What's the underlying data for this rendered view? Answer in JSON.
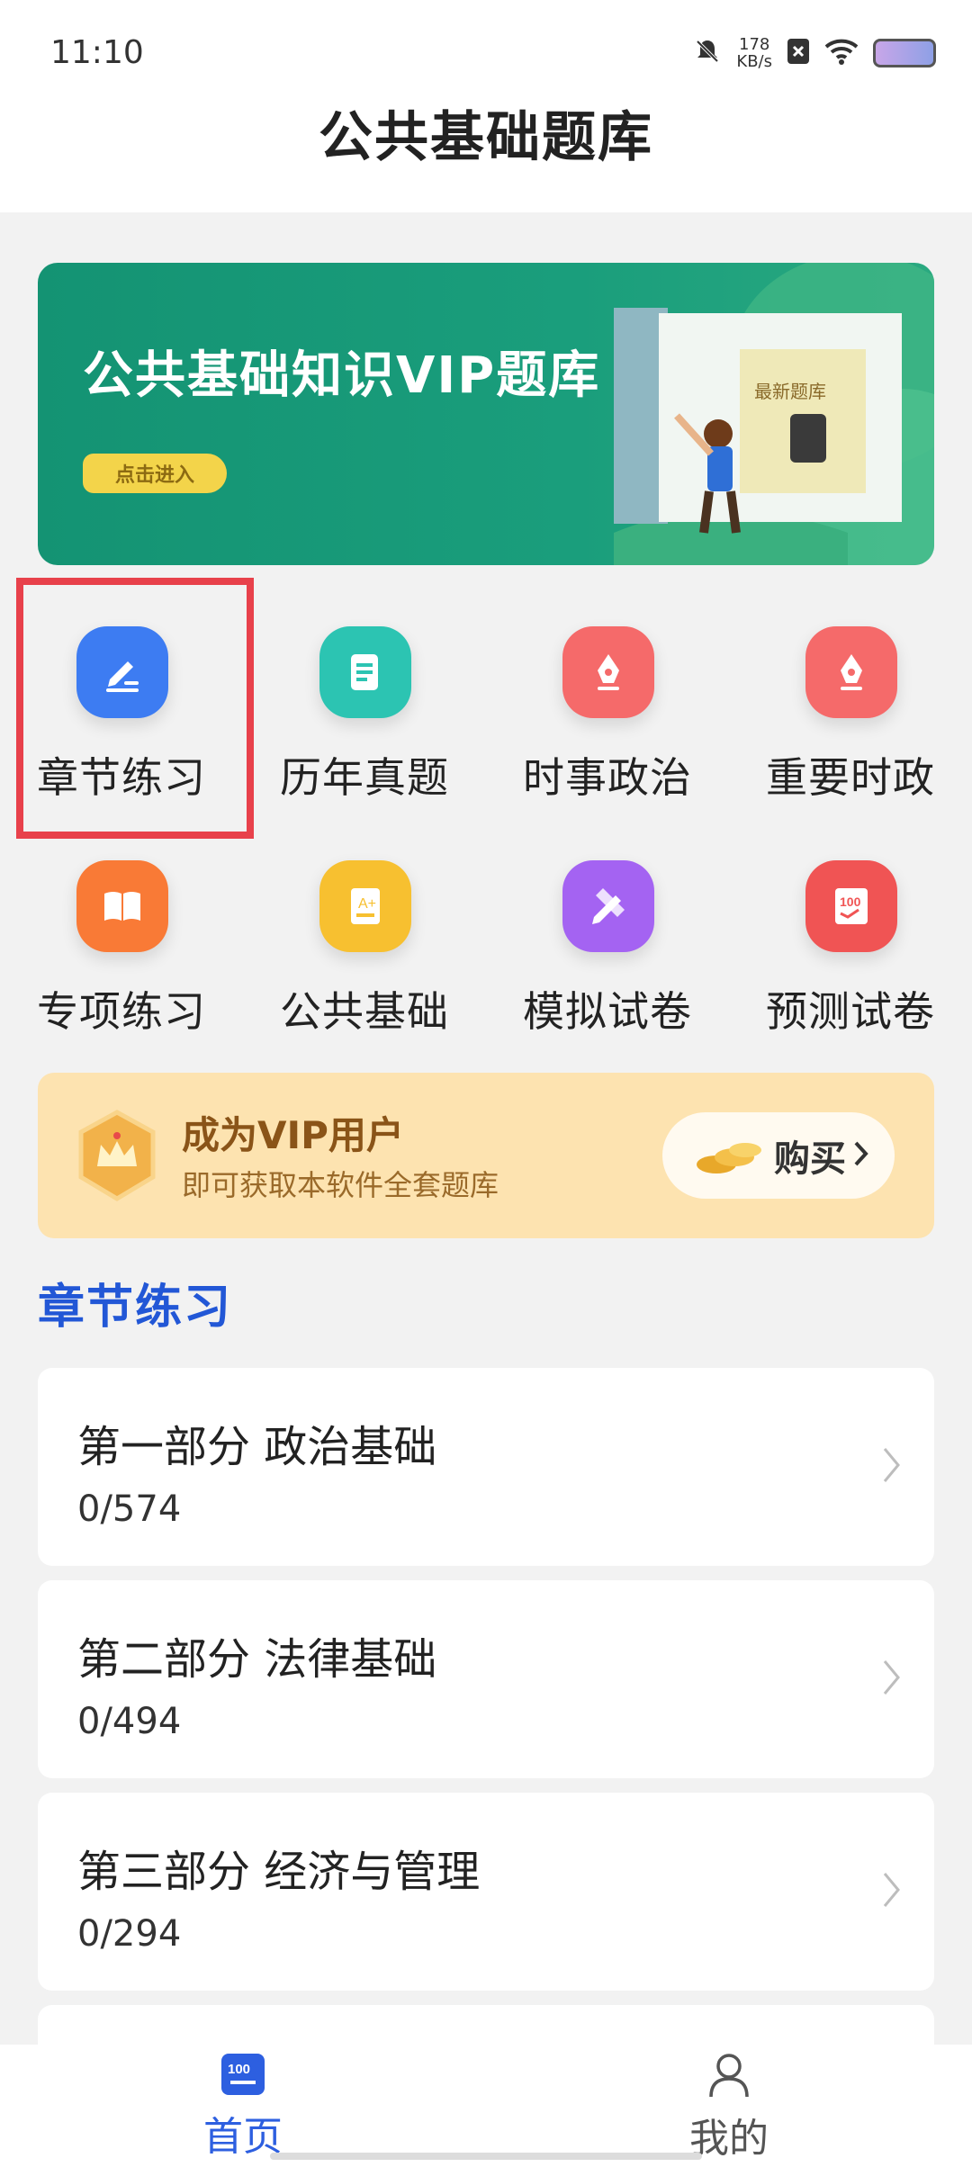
{
  "status_bar": {
    "time": "11:10",
    "net_speed_value": "178",
    "net_speed_unit": "KB/s"
  },
  "header": {
    "title": "公共基础题库"
  },
  "banner": {
    "title": "公共基础知识VIP题库",
    "button": "点击进入",
    "book_label": "最新题库"
  },
  "menu": [
    {
      "label": "章节练习",
      "icon": "edit-icon",
      "color": "#3d7cf2"
    },
    {
      "label": "历年真题",
      "icon": "document-icon",
      "color": "#2cc4b2"
    },
    {
      "label": "时事政治",
      "icon": "pen-nib-icon",
      "color": "#f56a6a"
    },
    {
      "label": "重要时政",
      "icon": "pen-nib-icon",
      "color": "#f56a6a"
    },
    {
      "label": "专项练习",
      "icon": "book-icon",
      "color": "#f97a36"
    },
    {
      "label": "公共基础",
      "icon": "certificate-icon",
      "color": "#f7c030"
    },
    {
      "label": "模拟试卷",
      "icon": "pencil-ruler-icon",
      "color": "#a463f2"
    },
    {
      "label": "预测试卷",
      "icon": "exam-100-icon",
      "color": "#f05454"
    }
  ],
  "vip": {
    "title": "成为VIP用户",
    "subtitle": "即可获取本软件全套题库",
    "buy_label": "购买"
  },
  "section_title": "章节练习",
  "chapters": [
    {
      "title": "第一部分 政治基础",
      "progress": "0/574"
    },
    {
      "title": "第二部分 法律基础",
      "progress": "0/494"
    },
    {
      "title": "第三部分 经济与管理",
      "progress": "0/294"
    }
  ],
  "bottom_nav": [
    {
      "label": "首页",
      "icon": "home-100-icon",
      "active": true,
      "color": "#2d5fe0"
    },
    {
      "label": "我的",
      "icon": "user-icon",
      "active": false,
      "color": "#555555"
    }
  ]
}
